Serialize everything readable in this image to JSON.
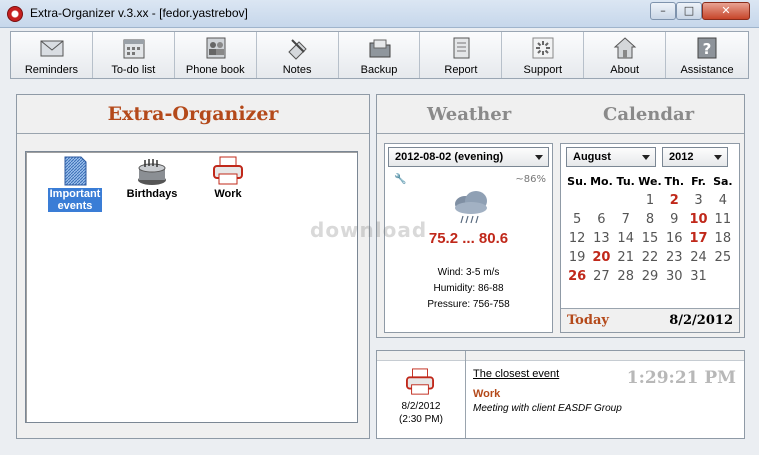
{
  "window": {
    "title": "Extra-Organizer v.3.xx - [fedor.yastrebov]",
    "min": "–",
    "max": "□",
    "close": "✕"
  },
  "toolbar": [
    {
      "label": "Reminders",
      "icon": "envelope-icon"
    },
    {
      "label": "To-do list",
      "icon": "calendar-icon"
    },
    {
      "label": "Phone book",
      "icon": "contacts-icon"
    },
    {
      "label": "Notes",
      "icon": "notes-icon"
    },
    {
      "label": "Backup",
      "icon": "folder-icon"
    },
    {
      "label": "Report",
      "icon": "report-icon"
    },
    {
      "label": "Support",
      "icon": "support-icon"
    },
    {
      "label": "About",
      "icon": "house-icon"
    },
    {
      "label": "Assistance",
      "icon": "help-icon"
    }
  ],
  "left": {
    "title": "Extra-Organizer",
    "items": [
      {
        "line1": "Important",
        "line2": "events",
        "selected": true,
        "icon": "document-icon"
      },
      {
        "line1": "Birthdays",
        "line2": "",
        "selected": false,
        "icon": "cake-icon"
      },
      {
        "line1": "Work",
        "line2": "",
        "selected": false,
        "icon": "printer-icon"
      }
    ]
  },
  "weather": {
    "header": "Weather",
    "date_selected": "2012-08-02 (evening)",
    "humidity_pct": "~86%",
    "temp": "75.2 ... 80.6",
    "wind": "Wind: 3-5 m/s",
    "humidity": "Humidity: 86-88",
    "pressure": "Pressure: 756-758",
    "icon": "rain-cloud-icon",
    "wrench": "🔧"
  },
  "calendar": {
    "header": "Calendar",
    "month": "August",
    "year": "2012",
    "weekdays": [
      "Su.",
      "Mo.",
      "Tu.",
      "We.",
      "Th.",
      "Fr.",
      "Sa."
    ],
    "weeks": [
      [
        "",
        "",
        "",
        "1",
        "2",
        "3",
        "4"
      ],
      [
        "5",
        "6",
        "7",
        "8",
        "9",
        "10",
        "11"
      ],
      [
        "12",
        "13",
        "14",
        "15",
        "16",
        "17",
        "18"
      ],
      [
        "19",
        "20",
        "21",
        "22",
        "23",
        "24",
        "25"
      ],
      [
        "26",
        "27",
        "28",
        "29",
        "30",
        "31",
        ""
      ]
    ],
    "event_days": [
      "2",
      "10",
      "17",
      "20",
      "26"
    ],
    "today_label": "Today",
    "today_date": "8/2/2012"
  },
  "closest_event": {
    "heading": "The closest event",
    "date": "8/2/2012",
    "time": "(2:30 PM)",
    "clock": "1:29:21 PM",
    "name": "Work",
    "description": "Meeting with client EASDF Group",
    "icon": "printer-icon"
  },
  "watermark": "download"
}
